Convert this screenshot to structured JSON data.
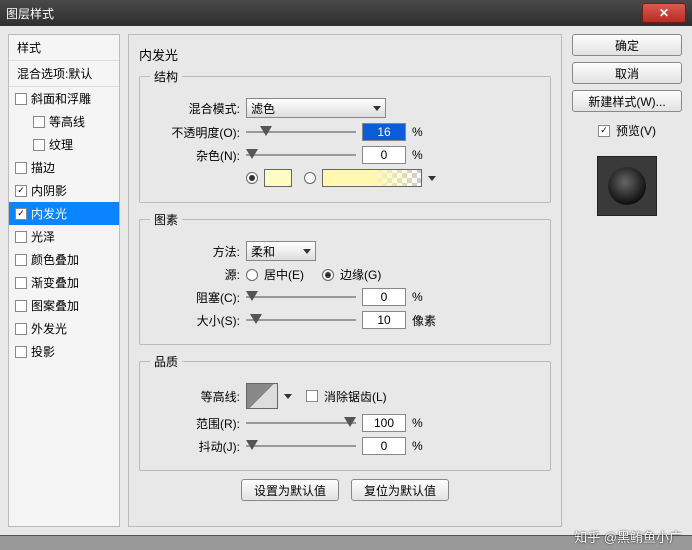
{
  "window": {
    "title": "图层样式"
  },
  "sidebar": {
    "header": "样式",
    "blend_header": "混合选项:默认",
    "items": [
      {
        "label": "斜面和浮雕",
        "checked": false,
        "indent": false
      },
      {
        "label": "等高线",
        "checked": false,
        "indent": true
      },
      {
        "label": "纹理",
        "checked": false,
        "indent": true
      },
      {
        "label": "描边",
        "checked": false,
        "indent": false
      },
      {
        "label": "内阴影",
        "checked": true,
        "indent": false
      },
      {
        "label": "内发光",
        "checked": true,
        "indent": false,
        "selected": true
      },
      {
        "label": "光泽",
        "checked": false,
        "indent": false
      },
      {
        "label": "颜色叠加",
        "checked": false,
        "indent": false
      },
      {
        "label": "渐变叠加",
        "checked": false,
        "indent": false
      },
      {
        "label": "图案叠加",
        "checked": false,
        "indent": false
      },
      {
        "label": "外发光",
        "checked": false,
        "indent": false
      },
      {
        "label": "投影",
        "checked": false,
        "indent": false
      }
    ]
  },
  "panel": {
    "title": "内发光",
    "structure": {
      "legend": "结构",
      "blend_mode_label": "混合模式:",
      "blend_mode_value": "滤色",
      "opacity_label": "不透明度(O):",
      "opacity_value": "16",
      "opacity_unit": "%",
      "noise_label": "杂色(N):",
      "noise_value": "0",
      "noise_unit": "%",
      "color_swatch": "#fffcc4",
      "fill_type_color_selected": true,
      "fill_type_gradient_selected": false
    },
    "elements": {
      "legend": "图素",
      "technique_label": "方法:",
      "technique_value": "柔和",
      "source_label": "源:",
      "source_center": "居中(E)",
      "source_edge": "边缘(G)",
      "source_edge_selected": true,
      "choke_label": "阻塞(C):",
      "choke_value": "0",
      "choke_unit": "%",
      "size_label": "大小(S):",
      "size_value": "10",
      "size_unit": "像素"
    },
    "quality": {
      "legend": "品质",
      "contour_label": "等高线:",
      "antialias_label": "消除锯齿(L)",
      "antialias_checked": false,
      "range_label": "范围(R):",
      "range_value": "100",
      "range_unit": "%",
      "jitter_label": "抖动(J):",
      "jitter_value": "0",
      "jitter_unit": "%"
    },
    "footer": {
      "set_default": "设置为默认值",
      "reset_default": "复位为默认值"
    }
  },
  "right": {
    "ok": "确定",
    "cancel": "取消",
    "new_style": "新建样式(W)...",
    "preview_label": "预览(V)",
    "preview_checked": true
  },
  "watermark": "知乎 @黑鲔鱼小广"
}
